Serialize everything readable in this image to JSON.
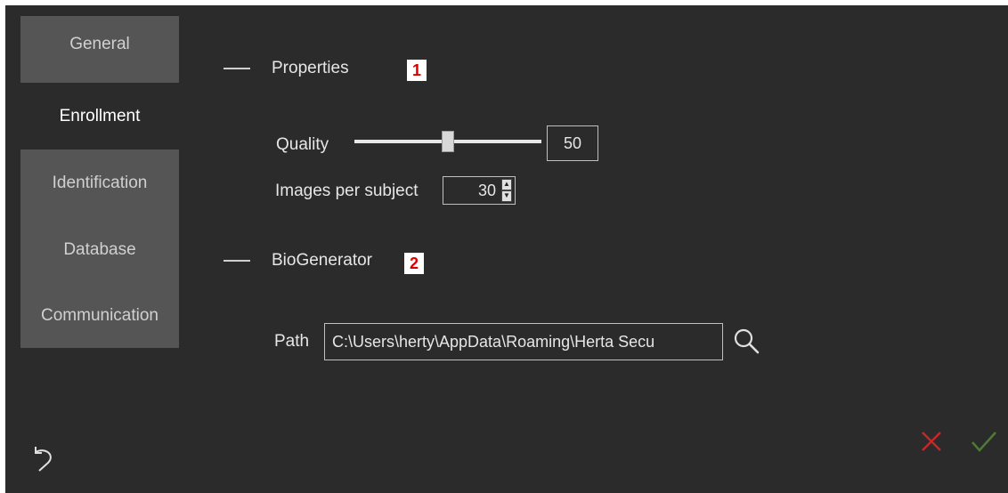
{
  "sidebar": {
    "items": [
      {
        "label": "General"
      },
      {
        "label": "Enrollment"
      },
      {
        "label": "Identification"
      },
      {
        "label": "Database"
      },
      {
        "label": "Communication"
      }
    ],
    "active_item": "Enrollment"
  },
  "sections": {
    "properties": {
      "title": "Properties",
      "marker": "1"
    },
    "biogenerator": {
      "title": "BioGenerator",
      "marker": "2"
    }
  },
  "quality": {
    "label": "Quality",
    "value": "50",
    "slider_fraction": 0.5
  },
  "images_per_subject": {
    "label": "Images per subject",
    "value": "30"
  },
  "path": {
    "label": "Path",
    "value": "C:\\Users\\herty\\AppData\\Roaming\\Herta Secu"
  },
  "footer": {
    "undo_icon": "undo-icon",
    "cancel_icon": "close-icon",
    "confirm_icon": "checkmark-icon"
  },
  "colors": {
    "background": "#2b2b2b",
    "sidebar_inactive": "#555555",
    "marker_text": "#d90000",
    "cancel": "#c62828",
    "confirm": "#4f7a33"
  }
}
